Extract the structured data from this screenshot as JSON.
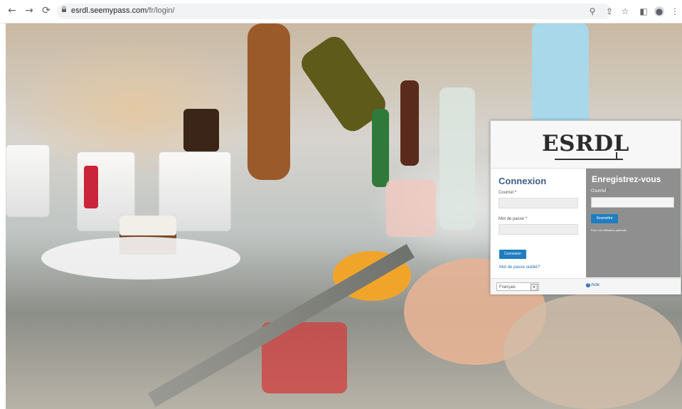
{
  "browser": {
    "url_domain": "esrdl.seemypass.com",
    "url_path": "/fr/login/"
  },
  "panel": {
    "logo_text": "ESRDL",
    "login": {
      "title": "Connexion",
      "email_label": "Courriel",
      "password_label": "Mot de passe",
      "required_mark": "*",
      "submit_label": "Connexion",
      "forgot_label": "Mot de passe oublié?"
    },
    "register": {
      "title": "Enregistrez-vous",
      "email_label": "Courriel",
      "submit_label": "Soumettre",
      "note": "Pour uns utilisation optimale"
    },
    "footer": {
      "language": "Français",
      "help_label": "Aide"
    }
  },
  "colors": {
    "accent": "#1f7ec0",
    "heading": "#3d5d8a",
    "register_bg": "#8f8f8f"
  }
}
